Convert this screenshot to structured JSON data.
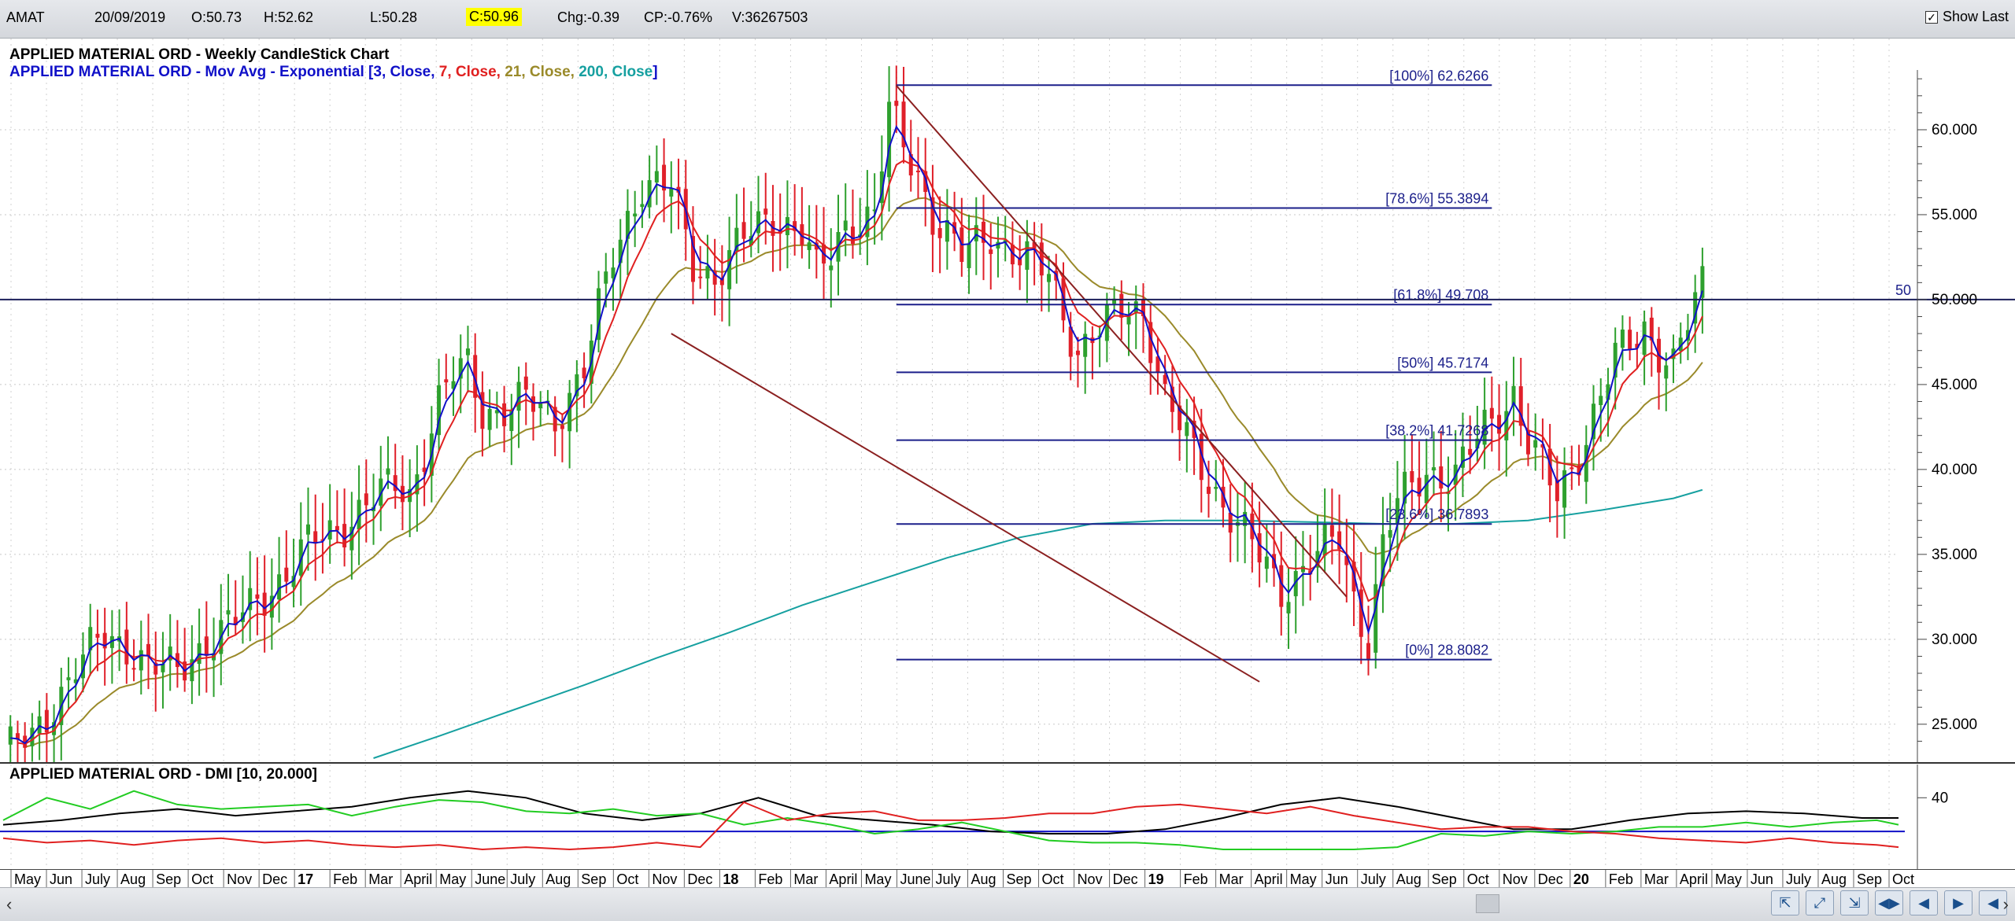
{
  "topbar": {
    "symbol": "AMAT",
    "date": "20/09/2019",
    "open": "O:50.73",
    "high": "H:52.62",
    "low": "L:50.28",
    "close": "C:50.96",
    "change": "Chg:-0.39",
    "change_pct": "CP:-0.76%",
    "volume": "V:36267503",
    "show_last_label": "Show Last",
    "show_last_checked": "✓"
  },
  "nav": {
    "scroll_left": "‹",
    "scroll_right": "›",
    "buttons": [
      "⇱",
      "⤢",
      "⇲",
      "◀▶",
      "◀",
      "▶",
      "◀"
    ]
  },
  "colors": {
    "candle_up": "#2ea02e",
    "candle_down": "#e0202a",
    "ema3": "#1010c8",
    "ema7": "#e02020",
    "ema21": "#9a8a2a",
    "ema200": "#16a0a0",
    "fib": "#1b1f8a",
    "trend": "#8b2020",
    "hline": "#1b1f5a",
    "dmi_plus": "#22cc22",
    "dmi_minus": "#e02020",
    "adx": "#000000",
    "dmi_ref": "#1010c8"
  },
  "chart_data": [
    {
      "type": "candlestick",
      "title": "APPLIED MATERIAL ORD - Weekly CandleStick Chart",
      "overlay_title": {
        "prefix": "APPLIED MATERIAL ORD - Mov Avg - Exponential [",
        "p1": "3",
        "c1": ", Close, ",
        "p2": "7",
        "c2": ", Close, ",
        "p3": "21",
        "c3": ", Close, ",
        "p4": "200",
        "c4": ", Close",
        "suffix": "]"
      },
      "ylim": [
        23.0,
        65.0
      ],
      "y_ticks": [
        "25.000",
        "30.000",
        "35.000",
        "40.000",
        "45.000",
        "50.000",
        "55.000",
        "60.000"
      ],
      "y_tick_values": [
        25,
        30,
        35,
        40,
        45,
        50,
        55,
        60
      ],
      "x_labels": [
        "May",
        "Jun",
        "July",
        "Aug",
        "Sep",
        "Oct",
        "Nov",
        "Dec",
        "17",
        "Feb",
        "Mar",
        "April",
        "May",
        "June",
        "July",
        "Aug",
        "Sep",
        "Oct",
        "Nov",
        "Dec",
        "18",
        "Feb",
        "Mar",
        "April",
        "May",
        "June",
        "July",
        "Aug",
        "Sep",
        "Oct",
        "Nov",
        "Dec",
        "19",
        "Feb",
        "Mar",
        "April",
        "May",
        "Jun",
        "July",
        "Aug",
        "Sep",
        "Oct",
        "Nov",
        "Dec",
        "20",
        "Feb",
        "Mar",
        "April",
        "May",
        "Jun",
        "July",
        "Aug",
        "Sep",
        "Oct"
      ],
      "x_label_bold": [
        "17",
        "18",
        "19",
        "20"
      ],
      "week_range": [
        0,
        261
      ],
      "price_path": [
        [
          0,
          23.5
        ],
        [
          4,
          24.0
        ],
        [
          10,
          28.5
        ],
        [
          14,
          30.0
        ],
        [
          18,
          29.5
        ],
        [
          20,
          28.5
        ],
        [
          24,
          28.0
        ],
        [
          28,
          30.0
        ],
        [
          32,
          31.0
        ],
        [
          38,
          33.5
        ],
        [
          42,
          35.5
        ],
        [
          46,
          36.5
        ],
        [
          50,
          38.0
        ],
        [
          54,
          39.0
        ],
        [
          56,
          38.5
        ],
        [
          60,
          44.0
        ],
        [
          62,
          45.5
        ],
        [
          64,
          46.0
        ],
        [
          66,
          43.5
        ],
        [
          68,
          43.5
        ],
        [
          72,
          44.0
        ],
        [
          76,
          43.0
        ],
        [
          80,
          46.0
        ],
        [
          84,
          52.5
        ],
        [
          88,
          57.0
        ],
        [
          92,
          56.5
        ],
        [
          95,
          52.0
        ],
        [
          98,
          51.5
        ],
        [
          102,
          53.5
        ],
        [
          106,
          55.0
        ],
        [
          110,
          54.0
        ],
        [
          112,
          51.5
        ],
        [
          114,
          52.5
        ],
        [
          116,
          54.5
        ],
        [
          120,
          55.0
        ],
        [
          122,
          61.0
        ],
        [
          124,
          59.0
        ],
        [
          126,
          57.5
        ],
        [
          128,
          55.0
        ],
        [
          132,
          52.5
        ],
        [
          136,
          54.0
        ],
        [
          140,
          52.5
        ],
        [
          144,
          51.5
        ],
        [
          148,
          47.0
        ],
        [
          152,
          48.5
        ],
        [
          154,
          49.5
        ],
        [
          157,
          49.5
        ],
        [
          160,
          44.0
        ],
        [
          164,
          41.0
        ],
        [
          168,
          38.0
        ],
        [
          172,
          35.5
        ],
        [
          176,
          33.0
        ],
        [
          180,
          34.5
        ],
        [
          184,
          36.0
        ],
        [
          186,
          32.5
        ],
        [
          188,
          30.0
        ],
        [
          190,
          35.5
        ],
        [
          192,
          38.0
        ],
        [
          196,
          40.0
        ],
        [
          200,
          39.5
        ],
        [
          204,
          42.5
        ],
        [
          208,
          44.5
        ],
        [
          210,
          41.5
        ],
        [
          214,
          38.5
        ],
        [
          218,
          42.0
        ],
        [
          222,
          46.5
        ],
        [
          226,
          48.5
        ],
        [
          228,
          47.0
        ],
        [
          230,
          46.0
        ],
        [
          232,
          48.5
        ],
        [
          234,
          51.0
        ]
      ],
      "ema200": [
        [
          51,
          23.0
        ],
        [
          60,
          24.3
        ],
        [
          70,
          25.8
        ],
        [
          80,
          27.3
        ],
        [
          90,
          28.9
        ],
        [
          100,
          30.4
        ],
        [
          110,
          32.0
        ],
        [
          120,
          33.4
        ],
        [
          130,
          34.8
        ],
        [
          140,
          36.0
        ],
        [
          150,
          36.8
        ],
        [
          160,
          37.0
        ],
        [
          170,
          37.0
        ],
        [
          180,
          36.9
        ],
        [
          190,
          36.8
        ],
        [
          200,
          36.8
        ],
        [
          210,
          37.0
        ],
        [
          220,
          37.6
        ],
        [
          230,
          38.3
        ],
        [
          234,
          38.8
        ]
      ],
      "fib_levels": [
        {
          "label": "[100%] 62.6266",
          "value": 62.6266
        },
        {
          "label": "[78.6%] 55.3894",
          "value": 55.3894
        },
        {
          "label": "[61.8%] 49.708",
          "value": 49.708
        },
        {
          "label": "[50%] 45.7174",
          "value": 45.7174
        },
        {
          "label": "[38.2%] 41.7268",
          "value": 41.7268
        },
        {
          "label": "[23.6%] 36.7893",
          "value": 36.7893
        },
        {
          "label": "[0%] 28.8082",
          "value": 28.8082
        }
      ],
      "fib_week_range": [
        123,
        205
      ],
      "hline": {
        "value": 50,
        "label": "50"
      },
      "trendlines": [
        {
          "from": [
            123,
            62.6
          ],
          "to": [
            185,
            32.5
          ]
        },
        {
          "from": [
            92,
            48.0
          ],
          "to": [
            173,
            27.5
          ]
        }
      ]
    },
    {
      "type": "line",
      "title": "APPLIED MATERIAL ORD - DMI [10, 20.000]",
      "y_ticks": [
        "40"
      ],
      "y_tick_values": [
        40
      ],
      "ylim": [
        10,
        52
      ],
      "ref_line": 25,
      "series": [
        {
          "key": "adx",
          "points": [
            [
              0,
              28
            ],
            [
              8,
              30
            ],
            [
              16,
              33
            ],
            [
              24,
              35
            ],
            [
              32,
              32
            ],
            [
              40,
              34
            ],
            [
              48,
              36
            ],
            [
              56,
              40
            ],
            [
              64,
              43
            ],
            [
              72,
              40
            ],
            [
              80,
              33
            ],
            [
              88,
              30
            ],
            [
              96,
              33
            ],
            [
              104,
              40
            ],
            [
              112,
              32
            ],
            [
              120,
              30
            ],
            [
              128,
              28
            ],
            [
              136,
              25
            ],
            [
              144,
              24
            ],
            [
              152,
              24
            ],
            [
              160,
              26
            ],
            [
              168,
              31
            ],
            [
              176,
              37
            ],
            [
              184,
              40
            ],
            [
              192,
              36
            ],
            [
              200,
              31
            ],
            [
              208,
              26
            ],
            [
              216,
              26
            ],
            [
              224,
              30
            ],
            [
              232,
              33
            ],
            [
              240,
              34
            ],
            [
              248,
              33
            ],
            [
              256,
              31
            ],
            [
              261,
              31
            ]
          ]
        },
        {
          "key": "dmi_plus",
          "points": [
            [
              0,
              30
            ],
            [
              6,
              40
            ],
            [
              12,
              35
            ],
            [
              18,
              43
            ],
            [
              24,
              37
            ],
            [
              30,
              35
            ],
            [
              36,
              36
            ],
            [
              42,
              37
            ],
            [
              48,
              32
            ],
            [
              54,
              36
            ],
            [
              60,
              39
            ],
            [
              66,
              38
            ],
            [
              72,
              34
            ],
            [
              78,
              33
            ],
            [
              84,
              35
            ],
            [
              90,
              32
            ],
            [
              96,
              33
            ],
            [
              102,
              28
            ],
            [
              108,
              31
            ],
            [
              114,
              28
            ],
            [
              120,
              24
            ],
            [
              126,
              26
            ],
            [
              132,
              29
            ],
            [
              138,
              25
            ],
            [
              144,
              21
            ],
            [
              150,
              20
            ],
            [
              156,
              20
            ],
            [
              162,
              19
            ],
            [
              168,
              17
            ],
            [
              174,
              17
            ],
            [
              180,
              17
            ],
            [
              186,
              17
            ],
            [
              192,
              18
            ],
            [
              198,
              24
            ],
            [
              204,
              23
            ],
            [
              210,
              25
            ],
            [
              216,
              24
            ],
            [
              222,
              25
            ],
            [
              228,
              27
            ],
            [
              234,
              27
            ],
            [
              240,
              29
            ],
            [
              246,
              27
            ],
            [
              252,
              29
            ],
            [
              258,
              30
            ],
            [
              261,
              28
            ]
          ]
        },
        {
          "key": "dmi_minus",
          "points": [
            [
              0,
              22
            ],
            [
              6,
              20
            ],
            [
              12,
              21
            ],
            [
              18,
              19
            ],
            [
              24,
              21
            ],
            [
              30,
              22
            ],
            [
              36,
              20
            ],
            [
              42,
              21
            ],
            [
              48,
              19
            ],
            [
              54,
              18
            ],
            [
              60,
              19
            ],
            [
              66,
              17
            ],
            [
              72,
              18
            ],
            [
              78,
              17
            ],
            [
              84,
              18
            ],
            [
              90,
              20
            ],
            [
              96,
              18
            ],
            [
              102,
              38
            ],
            [
              108,
              30
            ],
            [
              114,
              33
            ],
            [
              120,
              34
            ],
            [
              126,
              30
            ],
            [
              132,
              30
            ],
            [
              138,
              31
            ],
            [
              144,
              33
            ],
            [
              150,
              33
            ],
            [
              156,
              36
            ],
            [
              162,
              37
            ],
            [
              168,
              35
            ],
            [
              174,
              33
            ],
            [
              180,
              36
            ],
            [
              186,
              32
            ],
            [
              192,
              29
            ],
            [
              198,
              26
            ],
            [
              204,
              27
            ],
            [
              210,
              27
            ],
            [
              216,
              25
            ],
            [
              222,
              24
            ],
            [
              228,
              22
            ],
            [
              234,
              21
            ],
            [
              240,
              20
            ],
            [
              246,
              22
            ],
            [
              252,
              20
            ],
            [
              258,
              19
            ],
            [
              261,
              18
            ]
          ]
        }
      ]
    }
  ]
}
